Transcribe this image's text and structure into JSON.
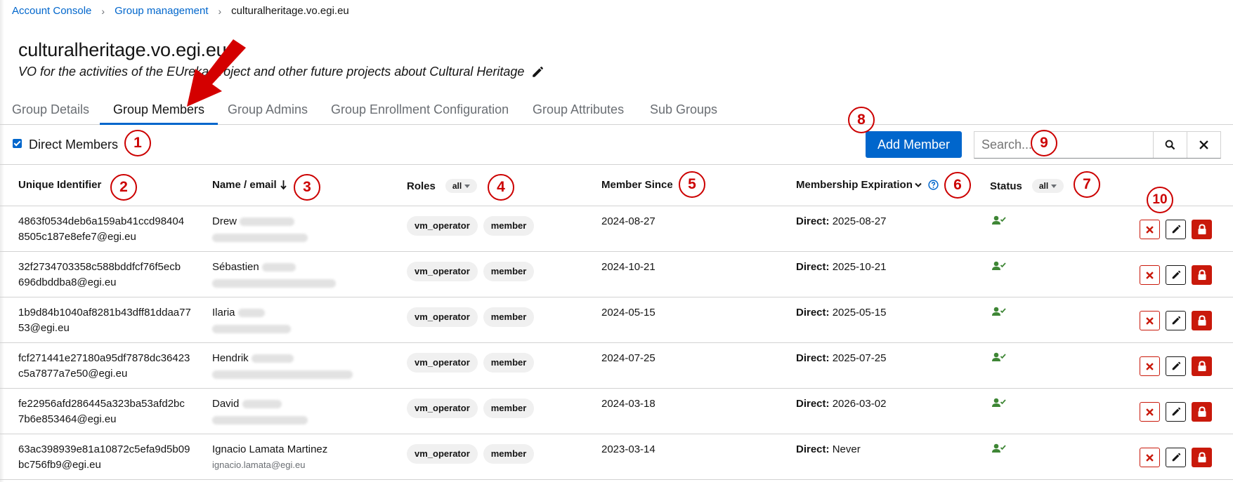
{
  "breadcrumb": {
    "item1": "Account Console",
    "item2": "Group management",
    "current": "culturalheritage.vo.egi.eu"
  },
  "group": {
    "title": "culturalheritage.vo.egi.eu",
    "description": "VO for the activities of the EUreka project and other future projects about Cultural Heritage"
  },
  "tabs": [
    {
      "label": "Group Details"
    },
    {
      "label": "Group Members"
    },
    {
      "label": "Group Admins"
    },
    {
      "label": "Group Enrollment Configuration"
    },
    {
      "label": "Group Attributes"
    },
    {
      "label": "Sub Groups"
    }
  ],
  "toolbar": {
    "direct_members_label": "Direct Members",
    "direct_members_checked": true,
    "add_member_label": "Add Member",
    "search_placeholder": "Search..."
  },
  "table": {
    "headers": {
      "uid": "Unique Identifier",
      "name": "Name / email",
      "roles": "Roles",
      "roles_filter": "all",
      "since": "Member Since",
      "expiration": "Membership Expiration",
      "status": "Status",
      "status_filter": "all"
    },
    "rows": [
      {
        "uid1": "4863f0534deb6a159ab41ccd98404",
        "uid2": "8505c187e8efe7@egi.eu",
        "name": "Drew",
        "email": "",
        "role1": "vm_operator",
        "role2": "member",
        "since": "2024-08-27",
        "exp_label": "Direct:",
        "exp_value": "2025-08-27"
      },
      {
        "uid1": "32f2734703358c588bddfcf76f5ecb",
        "uid2": "696dbddba8@egi.eu",
        "name": "Sébastien",
        "email": "",
        "role1": "vm_operator",
        "role2": "member",
        "since": "2024-10-21",
        "exp_label": "Direct:",
        "exp_value": "2025-10-21"
      },
      {
        "uid1": "1b9d84b1040af8281b43dff81ddaa77",
        "uid2": "53@egi.eu",
        "name": "Ilaria",
        "email": "",
        "role1": "vm_operator",
        "role2": "member",
        "since": "2024-05-15",
        "exp_label": "Direct:",
        "exp_value": "2025-05-15"
      },
      {
        "uid1": "fcf271441e27180a95df7878dc36423",
        "uid2": "c5a7877a7e50@egi.eu",
        "name": "Hendrik",
        "email": "",
        "role1": "vm_operator",
        "role2": "member",
        "since": "2024-07-25",
        "exp_label": "Direct:",
        "exp_value": "2025-07-25"
      },
      {
        "uid1": "fe22956afd286445a323ba53afd2bc",
        "uid2": "7b6e853464@egi.eu",
        "name": "David",
        "email": "",
        "role1": "vm_operator",
        "role2": "member",
        "since": "2024-03-18",
        "exp_label": "Direct:",
        "exp_value": "2026-03-02"
      },
      {
        "uid1": "63ac398939e81a10872c5efa9d5b09",
        "uid2": "bc756fb9@egi.eu",
        "name": "Ignacio Lamata Martinez",
        "email": "ignacio.lamata@egi.eu",
        "role1": "vm_operator",
        "role2": "member",
        "since": "2023-03-14",
        "exp_label": "Direct:",
        "exp_value": "Never"
      }
    ]
  },
  "annotations": [
    "1",
    "2",
    "3",
    "4",
    "5",
    "6",
    "7",
    "8",
    "9",
    "10"
  ],
  "colors": {
    "primary": "#0066cc",
    "danger": "#c9190b",
    "success": "#3e8635",
    "annotation": "#cc0000"
  },
  "icons": [
    "pencil-icon",
    "search-icon",
    "close-icon",
    "sort-down-icon",
    "chevron-down-icon",
    "help-icon",
    "user-check-icon",
    "delete-icon",
    "edit-icon",
    "lock-icon",
    "red-arrow-annotation"
  ]
}
